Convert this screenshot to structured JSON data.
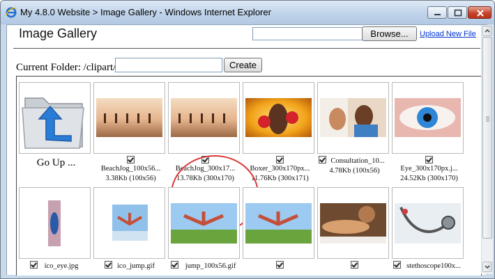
{
  "window": {
    "title": "My 4.8.0 Website > Image Gallery - Windows Internet Explorer",
    "icon": "ie-icon",
    "controls": [
      "minimize-icon",
      "maximize-icon",
      "close-icon"
    ]
  },
  "header": {
    "title": "Image Gallery",
    "file_value": "",
    "browse_label": "Browse...",
    "upload_label": "Upload New File"
  },
  "folder": {
    "label": "Current Folder: /clipart/",
    "input_value": "",
    "create_label": "Create"
  },
  "gallery": {
    "go_up_label": "Go Up ...",
    "row1": [
      {
        "name": "BeachJog_100x56...",
        "meta": "3.38Kb (100x56)"
      },
      {
        "name": "BeachJog_300x17...",
        "meta": "13.78Kb (300x170)",
        "highlighted": true
      },
      {
        "name": "Boxer_300x170px...",
        "meta": "11.76Kb (300x171)"
      },
      {
        "name": "Consultation_10...",
        "meta": "4.78Kb (100x56)"
      },
      {
        "name": "Eye_300x170px.j...",
        "meta": "24.52Kb (300x170)"
      }
    ],
    "row2": [
      {
        "name": "ico_eye.jpg"
      },
      {
        "name": "ico_jump.gif"
      },
      {
        "name": "jump_100x56.gif"
      },
      {
        "name": ""
      },
      {
        "name": ""
      },
      {
        "name": "stethoscope100x..."
      }
    ]
  },
  "colors": {
    "accent_link": "#0033cc",
    "highlight_circle": "#d9383a"
  }
}
